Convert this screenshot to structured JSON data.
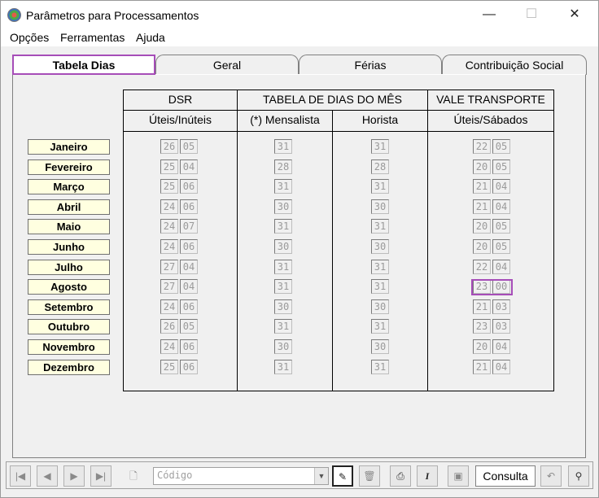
{
  "window": {
    "title": "Parâmetros para Processamentos",
    "minimize": "—",
    "maximize": "☐",
    "close": "✕"
  },
  "menu": [
    "Opções",
    "Ferramentas",
    "Ajuda"
  ],
  "tabs": [
    {
      "label": "Tabela Dias",
      "active": true
    },
    {
      "label": "Geral",
      "active": false
    },
    {
      "label": "Férias",
      "active": false
    },
    {
      "label": "Contribuição Social",
      "active": false
    }
  ],
  "headers": {
    "dsr": "DSR",
    "dsr_sub": "Úteis/Inúteis",
    "tabela": "TABELA DE DIAS DO MÊS",
    "mensalista": "(*) Mensalista",
    "horista": "Horista",
    "vale": "VALE TRANSPORTE",
    "vale_sub": "Úteis/Sábados"
  },
  "rows": [
    {
      "month": "Janeiro",
      "dsr": [
        "26",
        "05"
      ],
      "mensalista": "31",
      "horista": "31",
      "vt": [
        "22",
        "05"
      ]
    },
    {
      "month": "Fevereiro",
      "dsr": [
        "25",
        "04"
      ],
      "mensalista": "28",
      "horista": "28",
      "vt": [
        "20",
        "05"
      ]
    },
    {
      "month": "Março",
      "dsr": [
        "25",
        "06"
      ],
      "mensalista": "31",
      "horista": "31",
      "vt": [
        "21",
        "04"
      ]
    },
    {
      "month": "Abril",
      "dsr": [
        "24",
        "06"
      ],
      "mensalista": "30",
      "horista": "30",
      "vt": [
        "21",
        "04"
      ]
    },
    {
      "month": "Maio",
      "dsr": [
        "24",
        "07"
      ],
      "mensalista": "31",
      "horista": "31",
      "vt": [
        "20",
        "05"
      ]
    },
    {
      "month": "Junho",
      "dsr": [
        "24",
        "06"
      ],
      "mensalista": "30",
      "horista": "30",
      "vt": [
        "20",
        "05"
      ]
    },
    {
      "month": "Julho",
      "dsr": [
        "27",
        "04"
      ],
      "mensalista": "31",
      "horista": "31",
      "vt": [
        "22",
        "04"
      ]
    },
    {
      "month": "Agosto",
      "dsr": [
        "27",
        "04"
      ],
      "mensalista": "31",
      "horista": "31",
      "vt": [
        "23",
        "00"
      ]
    },
    {
      "month": "Setembro",
      "dsr": [
        "24",
        "06"
      ],
      "mensalista": "30",
      "horista": "30",
      "vt": [
        "21",
        "03"
      ]
    },
    {
      "month": "Outubro",
      "dsr": [
        "26",
        "05"
      ],
      "mensalista": "31",
      "horista": "31",
      "vt": [
        "23",
        "03"
      ]
    },
    {
      "month": "Novembro",
      "dsr": [
        "24",
        "06"
      ],
      "mensalista": "30",
      "horista": "30",
      "vt": [
        "20",
        "04"
      ]
    },
    {
      "month": "Dezembro",
      "dsr": [
        "25",
        "06"
      ],
      "mensalista": "31",
      "horista": "31",
      "vt": [
        "21",
        "04"
      ]
    }
  ],
  "highlighted_row": "Agosto",
  "toolbar": {
    "combo_placeholder": "Código",
    "consulta_label": "Consulta",
    "icons": [
      "first-record-icon",
      "prev-record-icon",
      "next-record-icon",
      "last-record-icon",
      "new-document-icon",
      "edit-icon",
      "delete-icon",
      "print-icon",
      "italic-icon",
      "save-icon",
      "undo-icon",
      "binoculars-icon"
    ]
  },
  "colors": {
    "highlight": "#a64db8",
    "month_bg": "#ffffe0"
  }
}
